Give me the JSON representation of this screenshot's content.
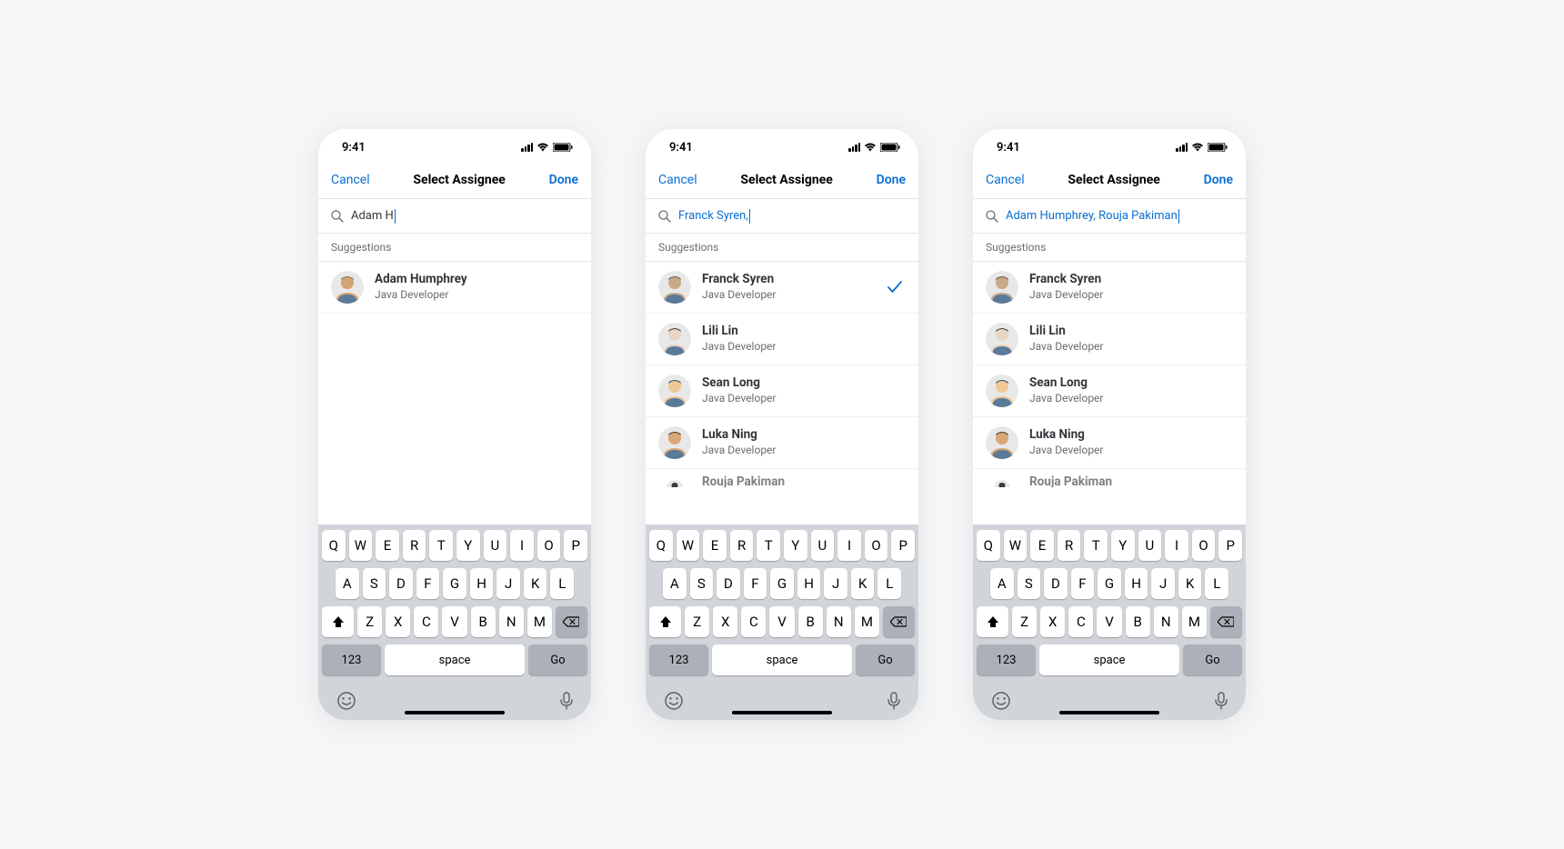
{
  "statusTime": "9:41",
  "nav": {
    "cancel": "Cancel",
    "title": "Select Assignee",
    "done": "Done"
  },
  "sectionHeader": "Suggestions",
  "keyboard": {
    "row1": [
      "Q",
      "W",
      "E",
      "R",
      "T",
      "Y",
      "U",
      "I",
      "O",
      "P"
    ],
    "row2": [
      "A",
      "S",
      "D",
      "F",
      "G",
      "H",
      "J",
      "K",
      "L"
    ],
    "row3": [
      "Z",
      "X",
      "C",
      "V",
      "B",
      "N",
      "M"
    ],
    "numKey": "123",
    "space": "space",
    "go": "Go"
  },
  "screens": [
    {
      "searchText": "Adam H",
      "searchStyle": "normal",
      "suggestions": [
        {
          "name": "Adam Humphrey",
          "role": "Java Developer",
          "checked": false,
          "avatar": "a1"
        }
      ],
      "partial": null
    },
    {
      "searchText": "Franck Syren, ",
      "searchStyle": "blue",
      "suggestions": [
        {
          "name": "Franck Syren",
          "role": "Java Developer",
          "checked": true,
          "avatar": "a2"
        },
        {
          "name": "Lili Lin",
          "role": "Java Developer",
          "checked": false,
          "avatar": "a3"
        },
        {
          "name": "Sean Long",
          "role": "Java Developer",
          "checked": false,
          "avatar": "a4"
        },
        {
          "name": "Luka Ning",
          "role": "Java Developer",
          "checked": false,
          "avatar": "a5"
        }
      ],
      "partial": {
        "name": "Rouja Pakiman",
        "role": "",
        "avatar": "a6"
      }
    },
    {
      "searchText": "Adam Humphrey, Rouja Pakiman",
      "searchStyle": "blue",
      "suggestions": [
        {
          "name": "Franck Syren",
          "role": "Java Developer",
          "checked": false,
          "avatar": "a2"
        },
        {
          "name": "Lili Lin",
          "role": "Java Developer",
          "checked": false,
          "avatar": "a3"
        },
        {
          "name": "Sean Long",
          "role": "Java Developer",
          "checked": false,
          "avatar": "a4"
        },
        {
          "name": "Luka Ning",
          "role": "Java Developer",
          "checked": false,
          "avatar": "a5"
        }
      ],
      "partial": {
        "name": "Rouja Pakiman",
        "role": "",
        "avatar": "a6"
      }
    }
  ],
  "avatarColors": {
    "a1": [
      "#d4a574",
      "#8b6f47"
    ],
    "a2": [
      "#c9a888",
      "#6b5943"
    ],
    "a3": [
      "#e8d5c4",
      "#3a3a3a"
    ],
    "a4": [
      "#f0c896",
      "#2e4a6b"
    ],
    "a5": [
      "#d9a876",
      "#4a3528"
    ],
    "a6": [
      "#3a3a3a",
      "#3a3a3a"
    ]
  }
}
